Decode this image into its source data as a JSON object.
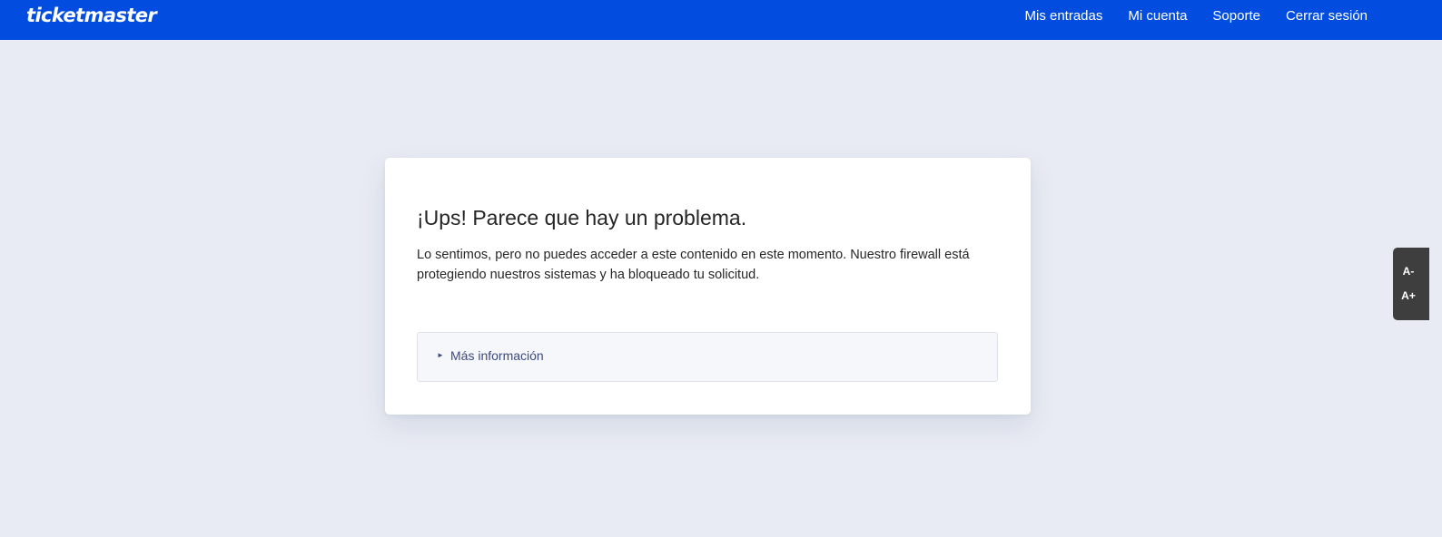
{
  "header": {
    "logo_text": "ticketmaster",
    "bg_color": "#024ddf",
    "nav": [
      {
        "label": "Mis entradas"
      },
      {
        "label": "Mi cuenta"
      },
      {
        "label": "Soporte"
      },
      {
        "label": "Cerrar sesión"
      }
    ]
  },
  "error_card": {
    "title": "¡Ups! Parece que hay un problema.",
    "message": "Lo sentimos, pero no puedes acceder a este contenido en este momento. Nuestro firewall está protegiendo nuestros sistemas y ha bloqueado tu solicitud.",
    "details_toggle_icon": "triangle-right-icon",
    "details_label": "Más información"
  },
  "font_size_controls": {
    "decrease_label": "A-",
    "increase_label": "A+"
  },
  "colors": {
    "page_bg": "#e8ebf3",
    "card_bg": "#ffffff",
    "details_text": "#3b4a82",
    "a11y_bg": "#3e3e3e"
  }
}
